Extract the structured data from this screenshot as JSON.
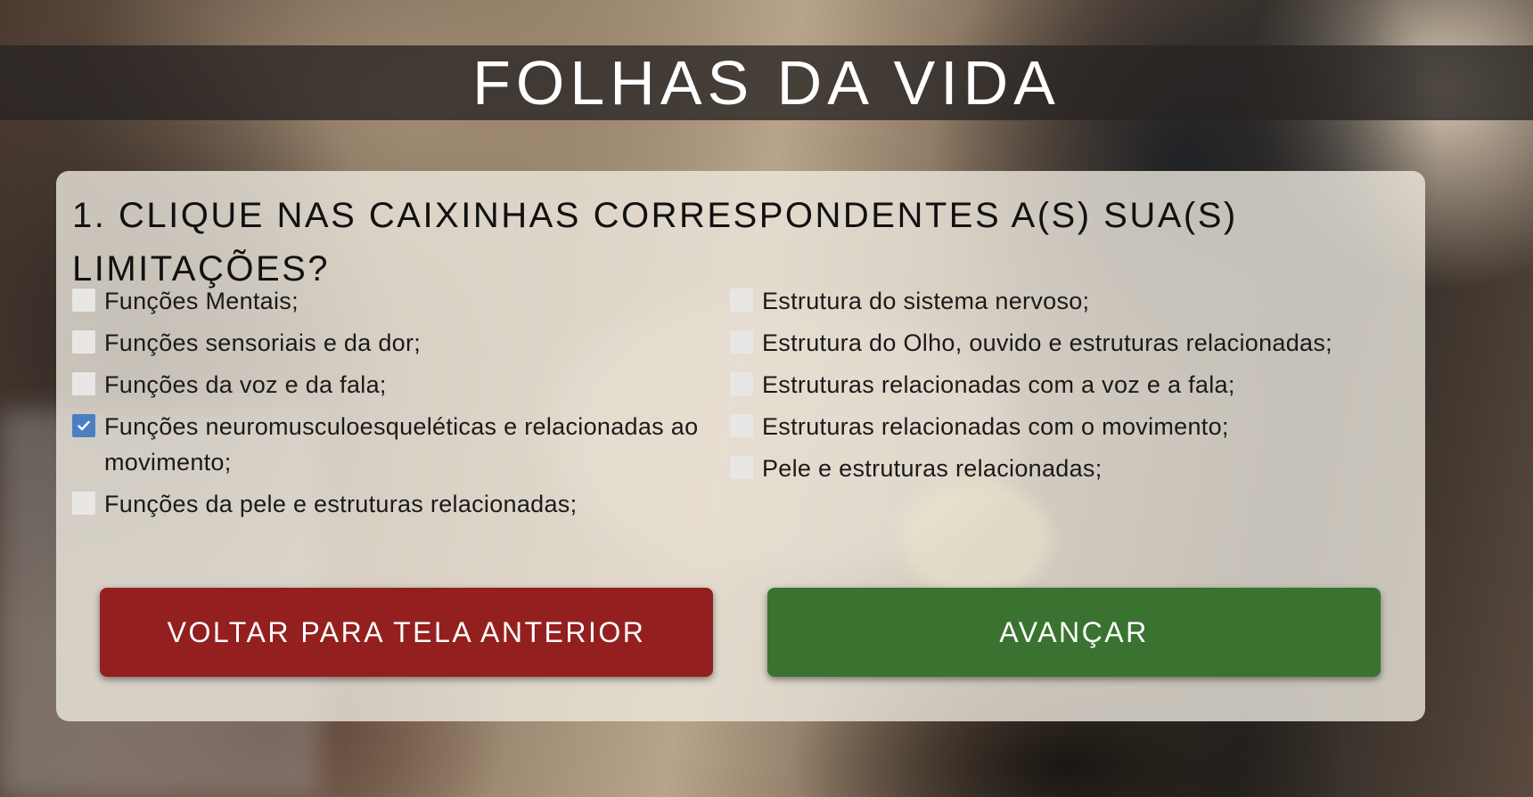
{
  "header": {
    "title": "FOLHAS DA VIDA"
  },
  "question": {
    "text": "1. CLIQUE NAS CAIXINHAS CORRESPONDENTES A(S) SUA(S) LIMITAÇÕES?"
  },
  "options_left": [
    {
      "label": "Funções Mentais;",
      "checked": false
    },
    {
      "label": "Funções sensoriais e da dor;",
      "checked": false
    },
    {
      "label": "Funções da voz e da fala;",
      "checked": false
    },
    {
      "label": "Funções neuromusculoesqueléticas e relacionadas ao movimento;",
      "checked": true
    },
    {
      "label": "Funções da pele e estruturas relacionadas;",
      "checked": false
    }
  ],
  "options_right": [
    {
      "label": "Estrutura do sistema nervoso;",
      "checked": false
    },
    {
      "label": "Estrutura do Olho, ouvido e estruturas relacionadas;",
      "checked": false
    },
    {
      "label": "Estruturas relacionadas com a voz e a fala;",
      "checked": false
    },
    {
      "label": "Estruturas relacionadas com o movimento;",
      "checked": false
    },
    {
      "label": "Pele e estruturas relacionadas;",
      "checked": false
    }
  ],
  "buttons": {
    "back_label": "VOLTAR PARA TELA ANTERIOR",
    "next_label": "AVANÇAR"
  },
  "colors": {
    "back_button": "#941f1f",
    "next_button": "#3a7230",
    "checkbox_checked": "#4a7fc4"
  },
  "icons": {
    "checkmark": "check-icon"
  }
}
